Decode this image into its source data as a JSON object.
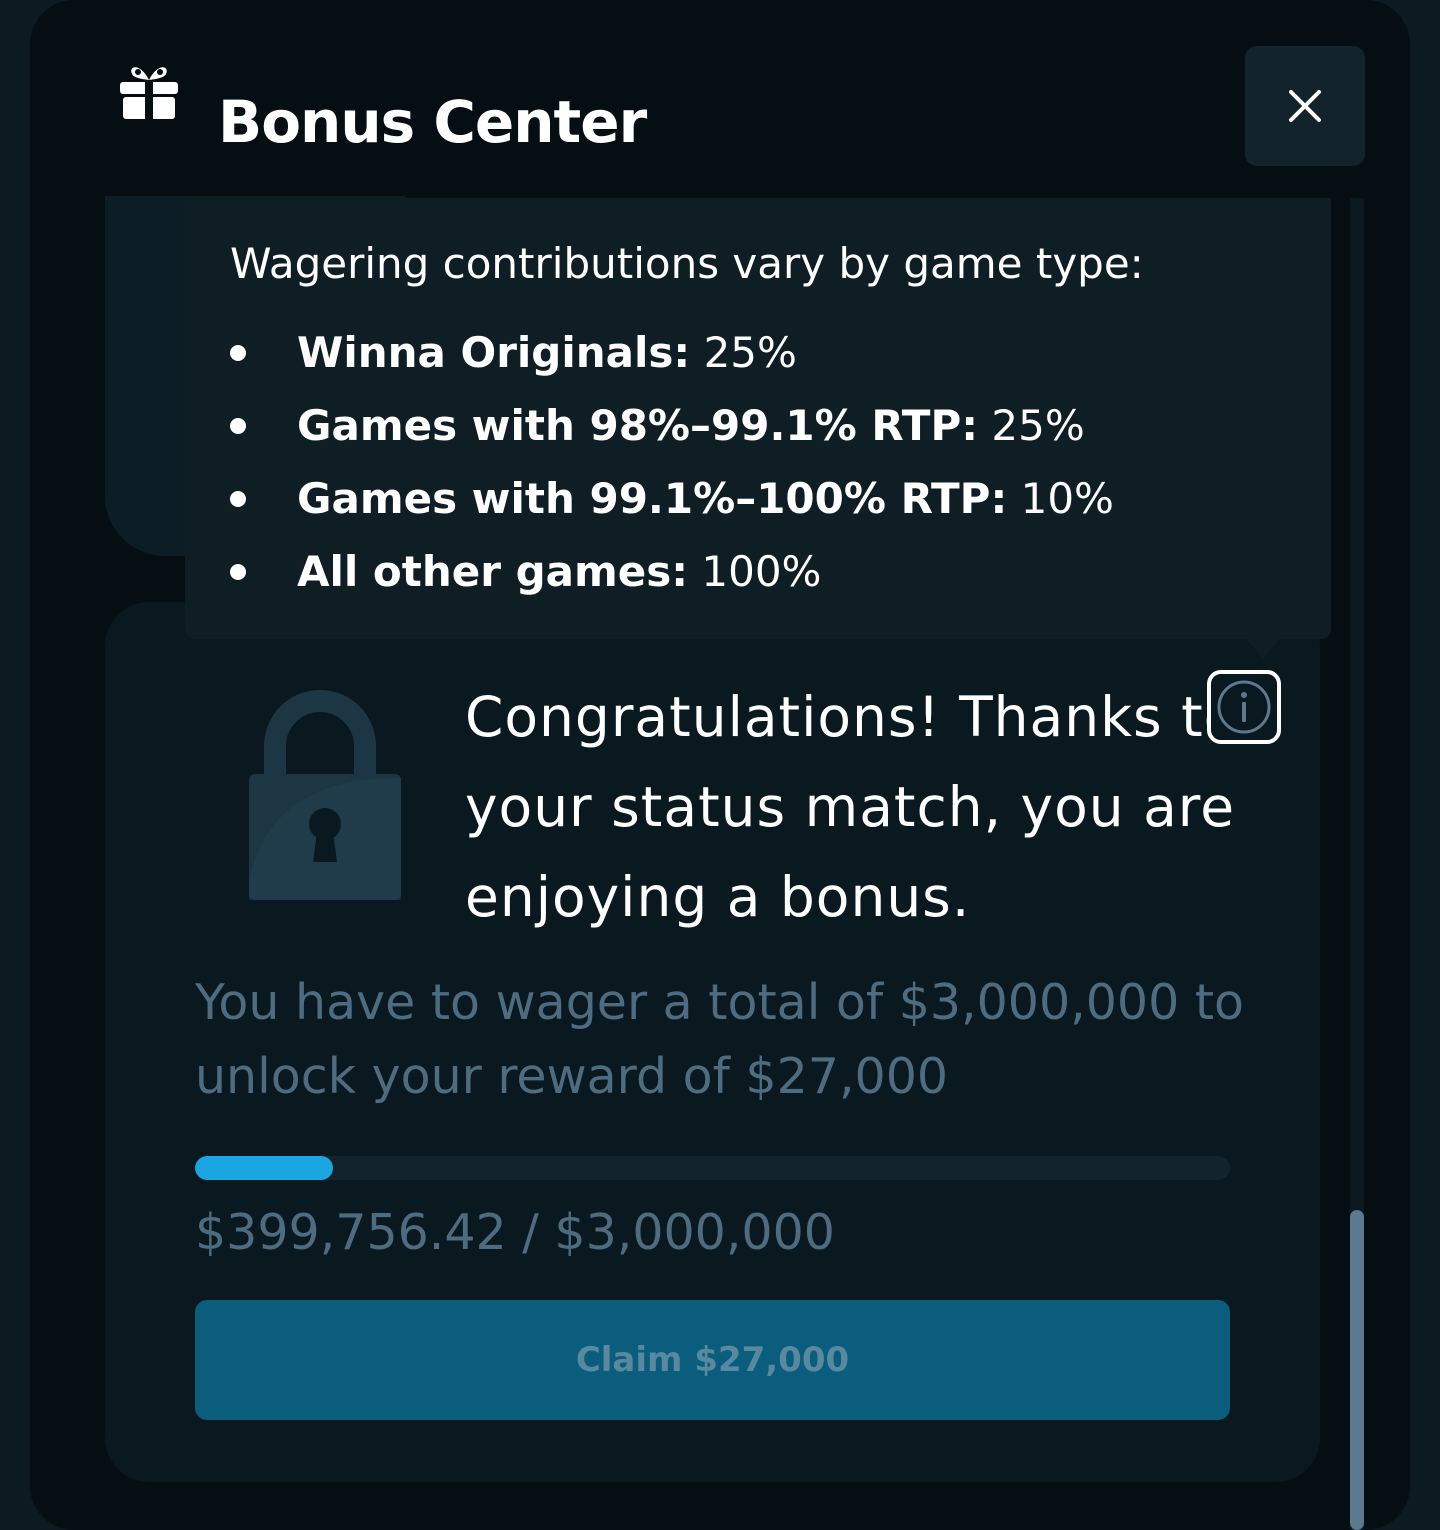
{
  "header": {
    "title": "Bonus Center",
    "icons": {
      "gift": "gift-icon",
      "close": "close-icon"
    }
  },
  "tooltip": {
    "title": "Wagering contributions vary by game type:",
    "items": [
      {
        "label": "Winna Originals:",
        "value": "25%"
      },
      {
        "label": "Games with 98%–99.1% RTP:",
        "value": "25%"
      },
      {
        "label": "Games with 99.1%–100% RTP:",
        "value": "10%"
      },
      {
        "label": "All other games:",
        "value": "100%"
      }
    ]
  },
  "bonus": {
    "message": "Congratulations! Thanks to your status match, you are enjoying a bonus.",
    "icons": {
      "lock": "lock-icon",
      "info": "info-icon"
    },
    "wager_text": "You have to wager a total of $3,000,000 to unlock your reward of $27,000",
    "progress": {
      "fraction": 0.1333,
      "text": "$399,756.42 / $3,000,000"
    },
    "claim_label": "Claim $27,000"
  },
  "colors": {
    "accent": "#1aa6e0",
    "claim_button": "#0a5d7d",
    "muted_text": "#4e6c80",
    "background": "#050e13"
  }
}
